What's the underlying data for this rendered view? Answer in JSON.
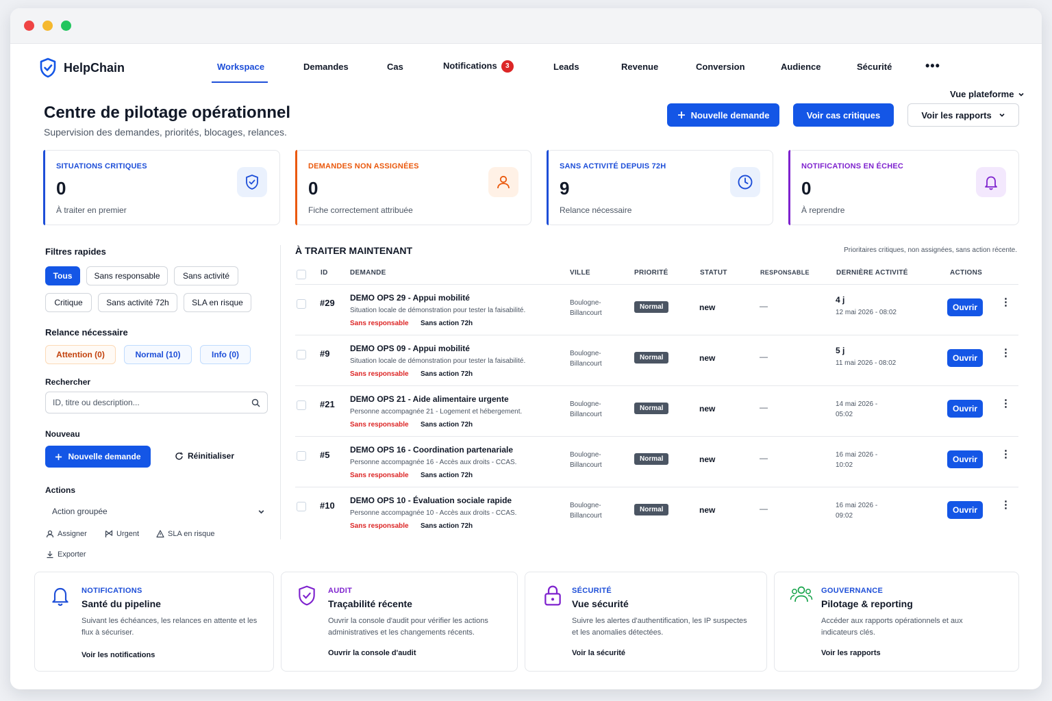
{
  "app": {
    "name": "HelpChain"
  },
  "nav": {
    "workspace": "Workspace",
    "demandes": "Demandes",
    "cas": "Cas",
    "notifications": "Notifications",
    "notifications_badge": "3",
    "leads": "Leads",
    "revenue": "Revenue",
    "conversion": "Conversion",
    "audience": "Audience",
    "securite": "Sécurité",
    "more": "•••",
    "platform_view": "Vue plateforme"
  },
  "header": {
    "title": "Centre de pilotage opérationnel",
    "subtitle": "Supervision des demandes, priorités, blocages, relances.",
    "new_request": "Nouvelle demande",
    "critical_cases": "Voir cas critiques",
    "reports": "Voir les rapports"
  },
  "kpis": [
    {
      "label": "SITUATIONS CRITIQUES",
      "value": "0",
      "sub": "À traiter en premier",
      "color": "#1d4ed8",
      "icon": "shield-check-icon"
    },
    {
      "label": "DEMANDES NON ASSIGNÉES",
      "value": "0",
      "sub": "Fiche correctement attribuée",
      "color": "#ea580c",
      "icon": "user-icon"
    },
    {
      "label": "SANS ACTIVITÉ DEPUIS 72H",
      "value": "9",
      "sub": "Relance nécessaire",
      "color": "#1d4ed8",
      "icon": "clock-icon"
    },
    {
      "label": "NOTIFICATIONS EN ÉCHEC",
      "value": "0",
      "sub": "À reprendre",
      "color": "#7e22ce",
      "icon": "bell-icon"
    }
  ],
  "filters": {
    "title": "Filtres rapides",
    "chips": [
      "Tous",
      "Sans responsable",
      "Sans activité",
      "Critique",
      "Sans activité 72h",
      "SLA en risque"
    ],
    "relance_title": "Relance nécessaire",
    "relance_chips": [
      "Attention (0)",
      "Normal (10)",
      "Info (0)"
    ],
    "search_title": "Rechercher",
    "search_placeholder": "ID, titre ou description...",
    "new_title": "Nouveau",
    "new_button": "Nouvelle demande",
    "reset": "Réinitialiser",
    "actions_title": "Actions",
    "group_action": "Action groupée",
    "assign": "Assigner",
    "urgent": "Urgent",
    "sla": "SLA en risque",
    "export": "Exporter"
  },
  "table": {
    "title": "À TRAITER MAINTENANT",
    "hint": "Prioritaires critiques, non assignées, sans action récente.",
    "columns": [
      "ID",
      "DEMANDE",
      "VILLE",
      "PRIORITÉ",
      "STATUT",
      "RESPONSABLE",
      "DERNIÈRE ACTIVITÉ",
      "ACTIONS"
    ],
    "open_label": "Ouvrir",
    "rows": [
      {
        "id": "#29",
        "title": "DEMO OPS 29 - Appui mobilité",
        "desc": "Situation locale de démonstration pour tester la faisabilité.",
        "tag1": "Sans responsable",
        "tag2": "Sans action 72h",
        "city1": "Boulogne-",
        "city2": "Billancourt",
        "priority": "Normal",
        "status": "new",
        "owner": "—",
        "activity_main": "4 j",
        "activity_sub": "12 mai 2026 - 08:02"
      },
      {
        "id": "#9",
        "title": "DEMO OPS 09 - Appui mobilité",
        "desc": "Situation locale de démonstration pour tester la faisabilité.",
        "tag1": "Sans responsable",
        "tag2": "Sans action 72h",
        "city1": "Boulogne-",
        "city2": "Billancourt",
        "priority": "Normal",
        "status": "new",
        "owner": "—",
        "activity_main": "5 j",
        "activity_sub": "11 mai 2026 - 08:02"
      },
      {
        "id": "#21",
        "title": "DEMO OPS 21 - Aide alimentaire urgente",
        "desc": "Personne accompagnée 21 - Logement et hébergement.",
        "tag1": "Sans responsable",
        "tag2": "Sans action 72h",
        "city1": "Boulogne-",
        "city2": "Billancourt",
        "priority": "Normal",
        "status": "new",
        "owner": "—",
        "activity_main": "14 mai 2026 -",
        "activity_sub": "05:02"
      },
      {
        "id": "#5",
        "title": "DEMO OPS 16 - Coordination partenariale",
        "desc": "Personne accompagnée 16 - Accès aux droits - CCAS.",
        "tag1": "Sans responsable",
        "tag2": "Sans action 72h",
        "city1": "Boulogne-",
        "city2": "Billancourt",
        "priority": "Normal",
        "status": "new",
        "owner": "—",
        "activity_main": "16 mai 2026 -",
        "activity_sub": "10:02"
      },
      {
        "id": "#10",
        "title": "DEMO OPS 10 - Évaluation sociale rapide",
        "desc": "Personne accompagnée 10 - Accès aux droits - CCAS.",
        "tag1": "Sans responsable",
        "tag2": "Sans action 72h",
        "city1": "Boulogne-",
        "city2": "Billancourt",
        "priority": "Normal",
        "status": "new",
        "owner": "—",
        "activity_main": "16 mai 2026 -",
        "activity_sub": "09:02"
      }
    ]
  },
  "cards": [
    {
      "label": "NOTIFICATIONS",
      "title": "Santé du pipeline",
      "desc": "Suivant les échéances, les relances en attente et les flux à sécuriser.",
      "action": "Voir les notifications",
      "color": "#1d4ed8",
      "icon": "bell-icon"
    },
    {
      "label": "AUDIT",
      "title": "Traçabilité récente",
      "desc": "Ouvrir la console d'audit pour vérifier les actions administratives et les changements récents.",
      "action": "Ouvrir la console d'audit",
      "color": "#7e22ce",
      "icon": "shield-check-icon"
    },
    {
      "label": "SÉCURITÉ",
      "title": "Vue sécurité",
      "desc": "Suivre les alertes d'authentification, les IP suspectes et les anomalies détectées.",
      "action": "Voir la sécurité",
      "color": "#1d4ed8",
      "icon": "lock-icon"
    },
    {
      "label": "GOUVERNANCE",
      "title": "Pilotage & reporting",
      "desc": "Accéder aux rapports opérationnels et aux indicateurs clés.",
      "action": "Voir les rapports",
      "color": "#1d4ed8",
      "icon": "users-icon"
    }
  ]
}
